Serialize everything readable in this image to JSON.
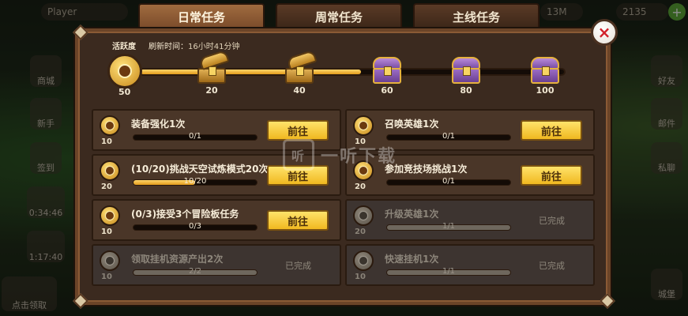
{
  "top_ghost": {
    "player_label": "Player",
    "currency_mid": "13M",
    "gems": "2135",
    "plus": "+"
  },
  "tabs": [
    {
      "label": "日常任务",
      "active": true
    },
    {
      "label": "周常任务",
      "active": false
    },
    {
      "label": "主线任务",
      "active": false
    }
  ],
  "close_label": "×",
  "activity": {
    "label": "活跃度",
    "refresh_label": "刷新时间：",
    "refresh_value": "16小时41分钟",
    "current": "50",
    "progress_fraction": 0.52,
    "milestones": [
      {
        "value": "20",
        "opened": true
      },
      {
        "value": "40",
        "opened": true
      },
      {
        "value": "60",
        "opened": false
      },
      {
        "value": "80",
        "opened": false
      },
      {
        "value": "100",
        "opened": false
      }
    ]
  },
  "tasks_left": [
    {
      "title": "装备强化1次",
      "points": "10",
      "progress": "0/1",
      "fraction": 0.0,
      "button": "前往",
      "done": false
    },
    {
      "title": "(10/20)挑战天空试炼模式20次",
      "points": "20",
      "progress": "10/20",
      "fraction": 0.5,
      "button": "前往",
      "done": false
    },
    {
      "title": "(0/3)接受3个冒险板任务",
      "points": "10",
      "progress": "0/3",
      "fraction": 0.0,
      "button": "前往",
      "done": false
    },
    {
      "title": "领取挂机资源产出2次",
      "points": "10",
      "progress": "2/2",
      "fraction": 1.0,
      "status": "已完成",
      "done": true
    }
  ],
  "tasks_right": [
    {
      "title": "召唤英雄1次",
      "points": "10",
      "progress": "0/1",
      "fraction": 0.0,
      "button": "前往",
      "done": false
    },
    {
      "title": "参加竞技场挑战1次",
      "points": "20",
      "progress": "0/1",
      "fraction": 0.0,
      "button": "前往",
      "done": false
    },
    {
      "title": "升级英雄1次",
      "points": "20",
      "progress": "1/1",
      "fraction": 1.0,
      "status": "已完成",
      "done": true
    },
    {
      "title": "快速挂机1次",
      "points": "10",
      "progress": "1/1",
      "fraction": 1.0,
      "status": "已完成",
      "done": true
    }
  ],
  "side_left": [
    "商城",
    "新手",
    "签到",
    "0:34:46",
    "1:17:40",
    "点击领取"
  ],
  "side_right": [
    "好友",
    "邮件",
    "私聊",
    "城堡"
  ],
  "watermark": {
    "icon": "听",
    "text": "一听下载"
  },
  "colors": {
    "accent_gold": "#f0b820",
    "panel_brown": "#3b2a1f",
    "close_red": "#d2202a"
  }
}
